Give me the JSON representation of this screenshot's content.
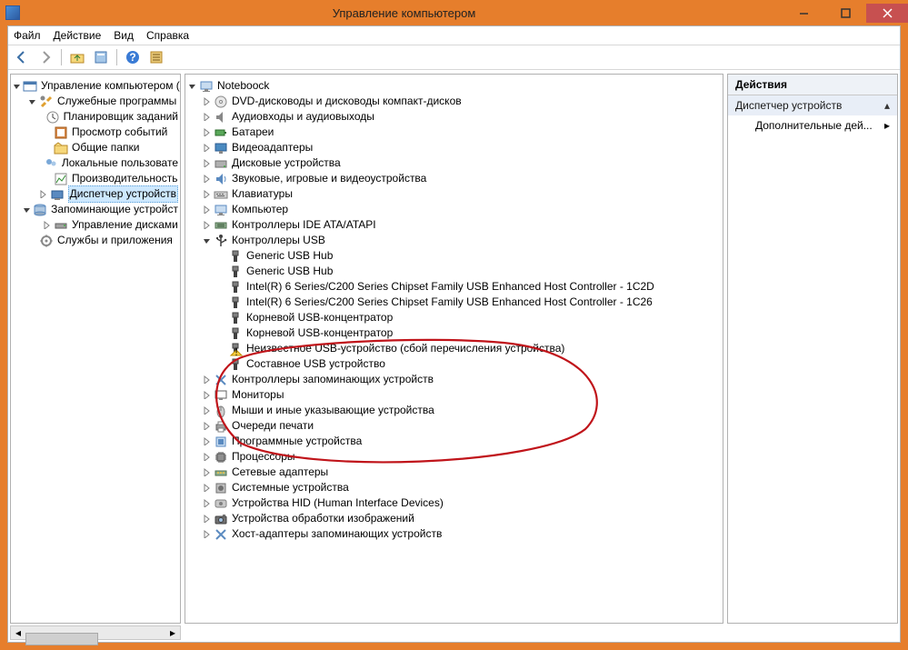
{
  "window": {
    "title": "Управление компьютером"
  },
  "menu": {
    "file": "Файл",
    "action": "Действие",
    "view": "Вид",
    "help": "Справка"
  },
  "left_tree": [
    {
      "depth": 0,
      "exp": "open",
      "icon": "console",
      "label": "Управление компьютером (л"
    },
    {
      "depth": 1,
      "exp": "open",
      "icon": "tools",
      "label": "Служебные программы"
    },
    {
      "depth": 2,
      "exp": "leaf",
      "icon": "clock",
      "label": "Планировщик заданий"
    },
    {
      "depth": 2,
      "exp": "leaf",
      "icon": "events",
      "label": "Просмотр событий"
    },
    {
      "depth": 2,
      "exp": "leaf",
      "icon": "folder-share",
      "label": "Общие папки"
    },
    {
      "depth": 2,
      "exp": "leaf",
      "icon": "users",
      "label": "Локальные пользовате"
    },
    {
      "depth": 2,
      "exp": "leaf",
      "icon": "perf",
      "label": "Производительность"
    },
    {
      "depth": 2,
      "exp": "closed",
      "icon": "device-mgr",
      "label": "Диспетчер устройств",
      "selected": true
    },
    {
      "depth": 1,
      "exp": "open",
      "icon": "storage",
      "label": "Запоминающие устройст"
    },
    {
      "depth": 2,
      "exp": "closed",
      "icon": "disk",
      "label": "Управление дисками"
    },
    {
      "depth": 1,
      "exp": "leaf",
      "icon": "services",
      "label": "Службы и приложения"
    }
  ],
  "device_tree": {
    "root": {
      "exp": "open",
      "icon": "computer",
      "label": "Noteboock"
    },
    "categories": [
      {
        "exp": "closed",
        "icon": "dvd",
        "label": "DVD-дисководы и дисководы компакт-дисков"
      },
      {
        "exp": "closed",
        "icon": "audio",
        "label": "Аудиовходы и аудиовыходы"
      },
      {
        "exp": "closed",
        "icon": "battery",
        "label": "Батареи"
      },
      {
        "exp": "closed",
        "icon": "display",
        "label": "Видеоадаптеры"
      },
      {
        "exp": "closed",
        "icon": "harddisk",
        "label": "Дисковые устройства"
      },
      {
        "exp": "closed",
        "icon": "sound",
        "label": "Звуковые, игровые и видеоустройства"
      },
      {
        "exp": "closed",
        "icon": "keyboard",
        "label": "Клавиатуры"
      },
      {
        "exp": "closed",
        "icon": "computer",
        "label": "Компьютер"
      },
      {
        "exp": "closed",
        "icon": "ide",
        "label": "Контроллеры IDE ATA/ATAPI"
      },
      {
        "exp": "open",
        "icon": "usb",
        "label": "Контроллеры USB",
        "children": [
          {
            "icon": "usb-plug",
            "label": "Generic USB Hub"
          },
          {
            "icon": "usb-plug",
            "label": "Generic USB Hub"
          },
          {
            "icon": "usb-plug",
            "label": "Intel(R) 6 Series/C200 Series Chipset Family USB Enhanced Host Controller - 1C2D"
          },
          {
            "icon": "usb-plug",
            "label": "Intel(R) 6 Series/C200 Series Chipset Family USB Enhanced Host Controller - 1C26"
          },
          {
            "icon": "usb-plug",
            "label": "Корневой USB-концентратор"
          },
          {
            "icon": "usb-plug",
            "label": "Корневой USB-концентратор"
          },
          {
            "icon": "usb-warn",
            "label": "Неизвестное USB-устройство (сбой перечисления устройства)"
          },
          {
            "icon": "usb-plug",
            "label": "Составное USB устройство"
          }
        ]
      },
      {
        "exp": "closed",
        "icon": "storage-ctl",
        "label": "Контроллеры запоминающих устройств"
      },
      {
        "exp": "closed",
        "icon": "monitor",
        "label": "Мониторы"
      },
      {
        "exp": "closed",
        "icon": "mouse",
        "label": "Мыши и иные указывающие устройства"
      },
      {
        "exp": "closed",
        "icon": "printer",
        "label": "Очереди печати"
      },
      {
        "exp": "closed",
        "icon": "software",
        "label": "Программные устройства"
      },
      {
        "exp": "closed",
        "icon": "cpu",
        "label": "Процессоры"
      },
      {
        "exp": "closed",
        "icon": "network",
        "label": "Сетевые адаптеры"
      },
      {
        "exp": "closed",
        "icon": "system",
        "label": "Системные устройства"
      },
      {
        "exp": "closed",
        "icon": "hid",
        "label": "Устройства HID (Human Interface Devices)"
      },
      {
        "exp": "closed",
        "icon": "imaging",
        "label": "Устройства обработки изображений"
      },
      {
        "exp": "closed",
        "icon": "storage-ctl",
        "label": "Хост-адаптеры запоминающих устройств"
      }
    ]
  },
  "actions": {
    "header": "Действия",
    "section": "Диспетчер устройств",
    "item": "Дополнительные дей..."
  }
}
